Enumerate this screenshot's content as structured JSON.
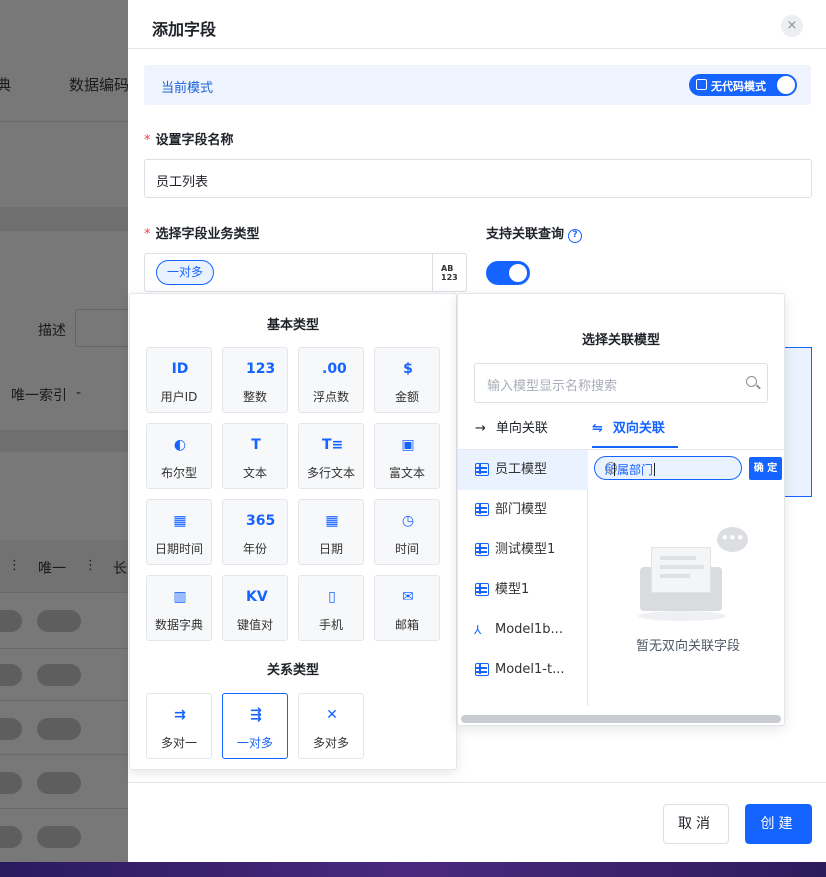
{
  "background": {
    "tab1": "典",
    "tab2": "数据编码",
    "desc_label": "描述",
    "index_label": "唯一索引",
    "index_value": "-",
    "col_unique": "唯一",
    "col_len": "长"
  },
  "drawer": {
    "title": "添加字段",
    "close_icon": "×"
  },
  "mode": {
    "label": "当前模式",
    "toggle_label": "无代码模式"
  },
  "field_name": {
    "required": "*",
    "label": "设置字段名称",
    "value": "员工列表"
  },
  "biz_type": {
    "required": "*",
    "label": "选择字段业务类型",
    "selected_tag": "一对多",
    "switch_icon_text": "ABC 123"
  },
  "relation_query": {
    "label": "支持关联查询",
    "help": "?"
  },
  "type_panel": {
    "basic_title": "基本类型",
    "basic_types": [
      {
        "label": "用户ID",
        "icon": "id-card-icon",
        "glyph": "ID"
      },
      {
        "label": "整数",
        "icon": "integer-icon",
        "glyph": "123"
      },
      {
        "label": "浮点数",
        "icon": "float-icon",
        "glyph": ".00"
      },
      {
        "label": "金额",
        "icon": "money-icon",
        "glyph": "$"
      },
      {
        "label": "布尔型",
        "icon": "toggle-icon",
        "glyph": "◐"
      },
      {
        "label": "文本",
        "icon": "text-icon",
        "glyph": "T"
      },
      {
        "label": "多行文本",
        "icon": "multiline-text-icon",
        "glyph": "T≡"
      },
      {
        "label": "富文本",
        "icon": "rich-text-icon",
        "glyph": "▣"
      },
      {
        "label": "日期时间",
        "icon": "datetime-icon",
        "glyph": "▦"
      },
      {
        "label": "年份",
        "icon": "year-icon",
        "glyph": "365"
      },
      {
        "label": "日期",
        "icon": "date-icon",
        "glyph": "▦"
      },
      {
        "label": "时间",
        "icon": "clock-icon",
        "glyph": "◷"
      },
      {
        "label": "数据字典",
        "icon": "dictionary-icon",
        "glyph": "▥"
      },
      {
        "label": "键值对",
        "icon": "key-value-icon",
        "glyph": "KV"
      },
      {
        "label": "手机",
        "icon": "mobile-icon",
        "glyph": "▯"
      },
      {
        "label": "邮箱",
        "icon": "mail-icon",
        "glyph": "✉"
      }
    ],
    "relation_title": "关系类型",
    "relation_types": [
      {
        "label": "多对一",
        "icon": "many-to-one-icon",
        "glyph": "⇉"
      },
      {
        "label": "一对多",
        "icon": "one-to-many-icon",
        "glyph": "⇶"
      },
      {
        "label": "多对多",
        "icon": "many-to-many-icon",
        "glyph": "✕"
      }
    ]
  },
  "relation_panel": {
    "title": "选择关联模型",
    "search_placeholder": "输入模型显示名称搜索",
    "tab_one_way": "单向关联",
    "tab_one_way_icon": "→",
    "tab_two_way": "双向关联",
    "tab_two_way_icon": "⇋",
    "models": [
      "员工模型",
      "部门模型",
      "测试模型1",
      "模型1",
      "Model1b...",
      "Model1-t..."
    ],
    "field_input_value": "所属部门",
    "confirm_label": "确 定",
    "empty_text": "暂无双向关联字段",
    "empty_bubble": "•••"
  },
  "footer": {
    "cancel_label": "取消",
    "create_label": "创建"
  }
}
